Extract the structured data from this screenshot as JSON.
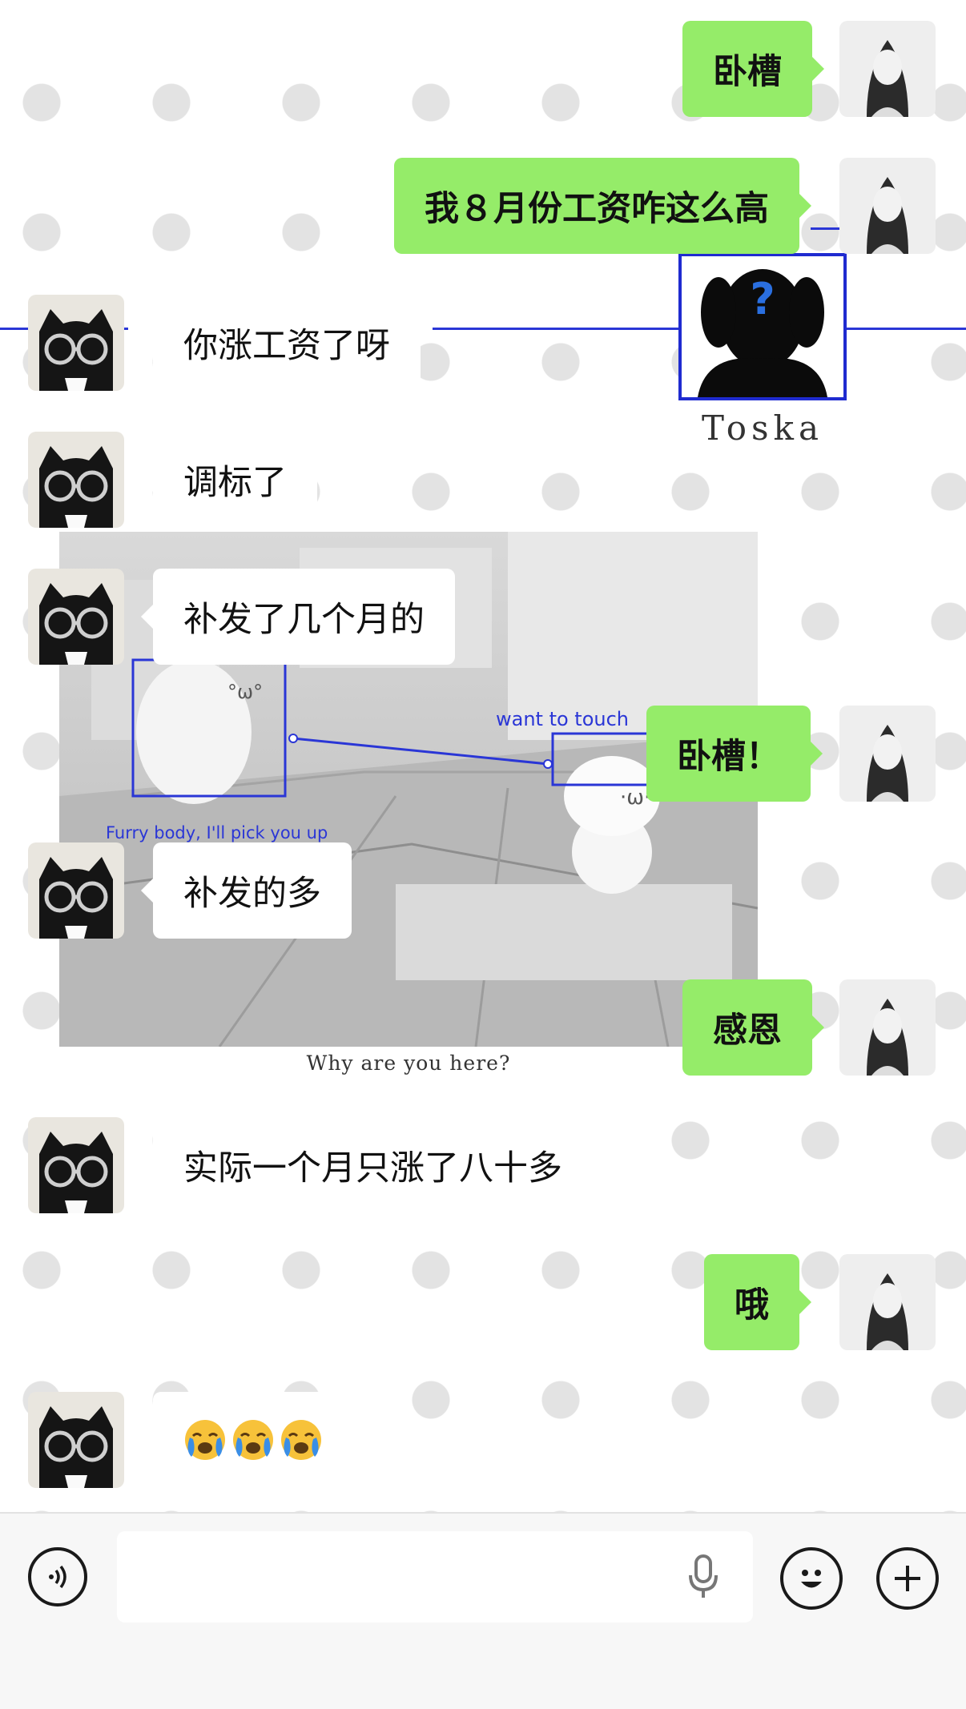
{
  "messages": [
    {
      "side": "out",
      "text": "卧槽"
    },
    {
      "side": "out",
      "text": "我８月份工资咋这么高"
    },
    {
      "side": "in",
      "text": "你涨工资了呀"
    },
    {
      "side": "in",
      "text": "调标了"
    },
    {
      "side": "in",
      "text": "补发了几个月的"
    },
    {
      "side": "out",
      "text": "卧槽！"
    },
    {
      "side": "in",
      "text": "补发的多"
    },
    {
      "side": "out",
      "text": "感恩"
    },
    {
      "side": "in",
      "text": "实际一个月只涨了八十多"
    },
    {
      "side": "out",
      "text": "哦"
    },
    {
      "side": "in",
      "emoji": [
        "loudly-crying-face",
        "loudly-crying-face",
        "loudly-crying-face"
      ]
    }
  ],
  "overlay": {
    "toska_name": "Toska",
    "scene_label_left": "Furry body, I'll pick you up",
    "scene_label_right": "want to touch",
    "scene_caption": "Why are you here?"
  },
  "colors": {
    "outgoing_bubble": "#95ec69",
    "incoming_bubble": "#ffffff",
    "overlay_blue": "#2a36d6"
  },
  "input_bar": {
    "icons": [
      "voice-icon",
      "microphone-icon",
      "emoji-icon",
      "plus-icon"
    ]
  }
}
